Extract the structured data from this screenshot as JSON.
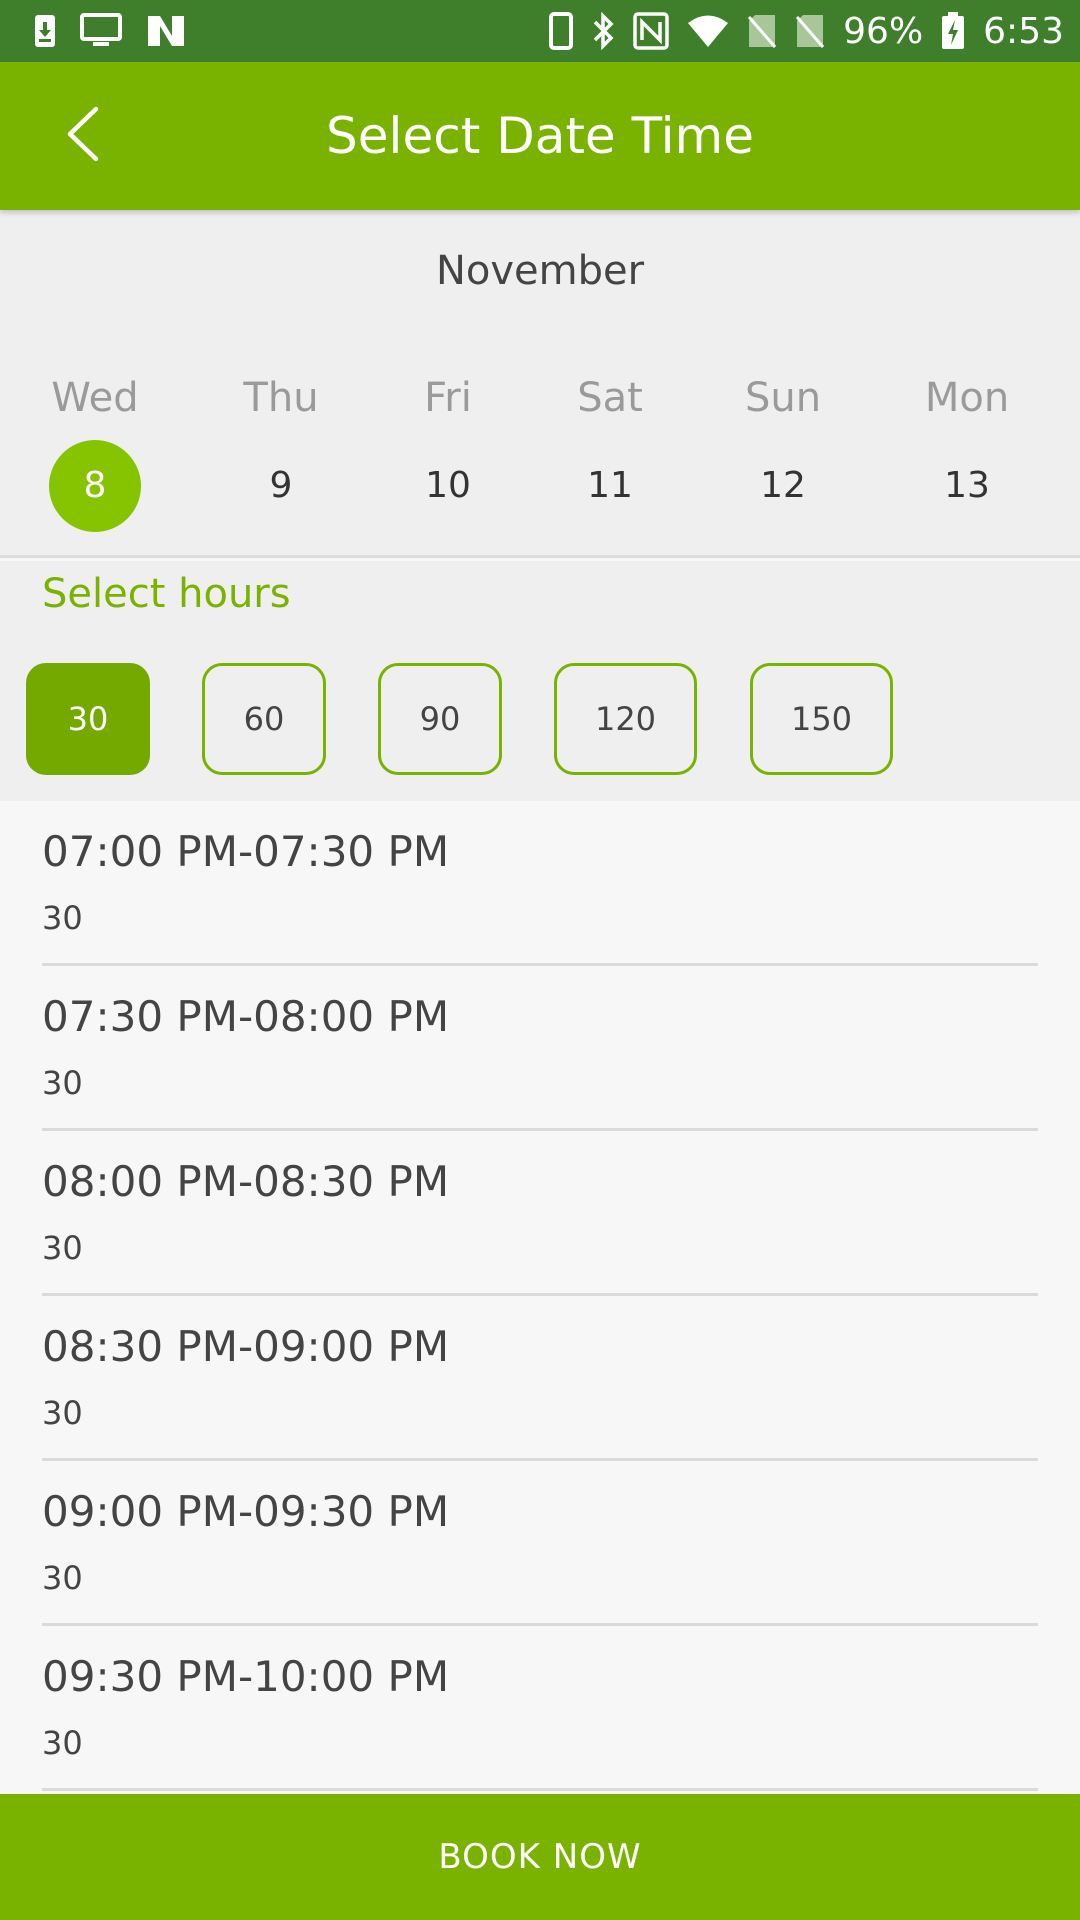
{
  "status_bar": {
    "battery_percent": "96%",
    "time": "6:53",
    "left_icons": [
      "download-icon",
      "monitor-icon",
      "n-app-icon"
    ],
    "right_icons": [
      "phone-icon",
      "bluetooth-icon",
      "nfc-icon",
      "wifi-icon",
      "no-sim-icon",
      "no-sim-icon",
      "battery-charging-icon"
    ]
  },
  "app_bar": {
    "title": "Select Date Time",
    "back_icon": "chevron-left-icon"
  },
  "calendar": {
    "month": "November",
    "days": [
      {
        "name": "Wed",
        "num": "8",
        "selected": true
      },
      {
        "name": "Thu",
        "num": "9",
        "selected": false
      },
      {
        "name": "Fri",
        "num": "10",
        "selected": false
      },
      {
        "name": "Sat",
        "num": "11",
        "selected": false
      },
      {
        "name": "Sun",
        "num": "12",
        "selected": false
      },
      {
        "name": "Mon",
        "num": "13",
        "selected": false
      }
    ]
  },
  "hours": {
    "label": "Select hours",
    "options": [
      "30",
      "60",
      "90",
      "120",
      "150"
    ],
    "selected": "30"
  },
  "slots": [
    {
      "time": "07:00 PM-07:30 PM",
      "duration": "30"
    },
    {
      "time": "07:30 PM-08:00 PM",
      "duration": "30"
    },
    {
      "time": "08:00 PM-08:30 PM",
      "duration": "30"
    },
    {
      "time": "08:30 PM-09:00 PM",
      "duration": "30"
    },
    {
      "time": "09:00 PM-09:30 PM",
      "duration": "30"
    },
    {
      "time": "09:30 PM-10:00 PM",
      "duration": "30"
    }
  ],
  "book_button": {
    "label": "BOOK NOW"
  },
  "colors": {
    "status_bar": "#3f7f2c",
    "primary": "#7ab200",
    "selected_day": "#86c400",
    "selected_chip": "#74aa00"
  }
}
